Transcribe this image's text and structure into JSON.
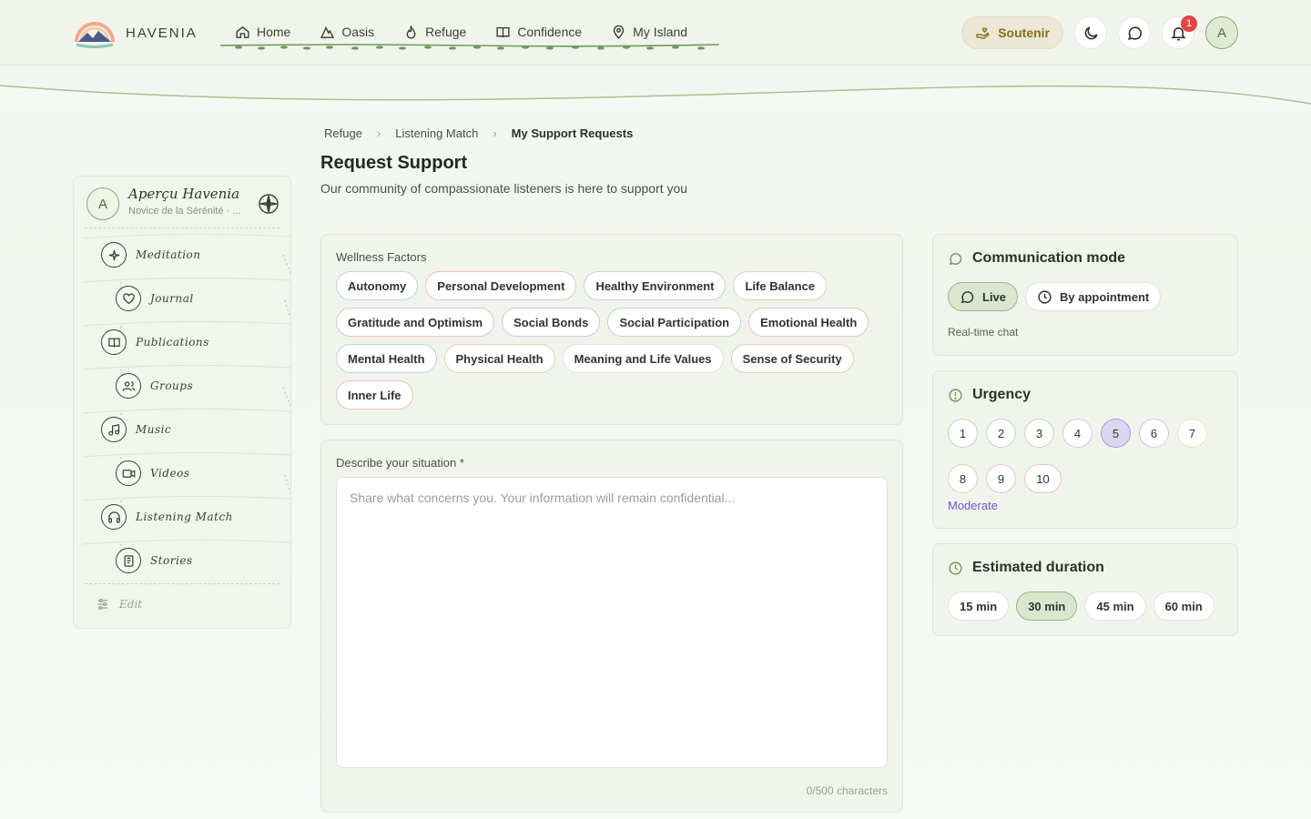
{
  "header": {
    "brand": "HAVENIA",
    "nav": [
      {
        "label": "Home",
        "icon": "home-icon"
      },
      {
        "label": "Oasis",
        "icon": "mountain-icon"
      },
      {
        "label": "Refuge",
        "icon": "flame-icon"
      },
      {
        "label": "Confidence",
        "icon": "book-icon"
      },
      {
        "label": "My Island",
        "icon": "map-pin-icon"
      }
    ],
    "support_label": "Soutenir",
    "notification_count": "1",
    "avatar_initial": "A"
  },
  "sidebar": {
    "avatar_initial": "A",
    "name": "Aperçu Havenia",
    "level": "Novice de la Sérénité · ...",
    "items": [
      {
        "label": "Meditation",
        "icon": "sparkle-icon"
      },
      {
        "label": "Journal",
        "icon": "heart-icon"
      },
      {
        "label": "Publications",
        "icon": "book-open-icon"
      },
      {
        "label": "Groups",
        "icon": "users-icon"
      },
      {
        "label": "Music",
        "icon": "music-icon"
      },
      {
        "label": "Videos",
        "icon": "video-icon"
      },
      {
        "label": "Listening Match",
        "icon": "headphones-icon"
      },
      {
        "label": "Stories",
        "icon": "notebook-icon"
      }
    ],
    "edit_label": "Edit"
  },
  "breadcrumb": [
    "Refuge",
    "Listening Match",
    "My Support Requests"
  ],
  "page": {
    "title": "Request Support",
    "subtitle": "Our community of compassionate listeners is here to support you"
  },
  "wellness": {
    "label": "Wellness Factors",
    "factors": [
      {
        "label": "Autonomy",
        "color": "blue"
      },
      {
        "label": "Personal Development",
        "color": "red"
      },
      {
        "label": "Healthy Environment",
        "color": "green"
      },
      {
        "label": "Life Balance",
        "color": "tan"
      },
      {
        "label": "Gratitude and Optimism",
        "color": "red"
      },
      {
        "label": "Social Bonds",
        "color": "purple"
      },
      {
        "label": "Social Participation",
        "color": "green"
      },
      {
        "label": "Emotional Health",
        "color": "red"
      },
      {
        "label": "Mental Health",
        "color": "blue"
      },
      {
        "label": "Physical Health",
        "color": "tan"
      },
      {
        "label": "Meaning and Life Values",
        "color": "plain"
      },
      {
        "label": "Sense of Security",
        "color": "tan"
      },
      {
        "label": "Inner Life",
        "color": "red"
      }
    ]
  },
  "situation": {
    "label": "Describe your situation *",
    "value": "",
    "placeholder": "Share what concerns you. Your information will remain confidential...",
    "char_count": "0/500 characters"
  },
  "communication": {
    "title": "Communication mode",
    "options": [
      {
        "label": "Live",
        "active": true
      },
      {
        "label": "By appointment",
        "active": false
      }
    ],
    "description": "Real-time chat"
  },
  "urgency": {
    "title": "Urgency",
    "levels": [
      "1",
      "2",
      "3",
      "4",
      "5",
      "6",
      "7",
      "8",
      "9",
      "10"
    ],
    "selected": "5",
    "status": "Moderate"
  },
  "duration": {
    "title": "Estimated duration",
    "options": [
      "15 min",
      "30 min",
      "45 min",
      "60 min"
    ],
    "selected": "30 min"
  },
  "colors": {
    "accent_green": "#6e9a55",
    "urgency_purple": "#6c56c8",
    "alert_red": "#e24343",
    "support_gold": "#8a6d1c"
  }
}
